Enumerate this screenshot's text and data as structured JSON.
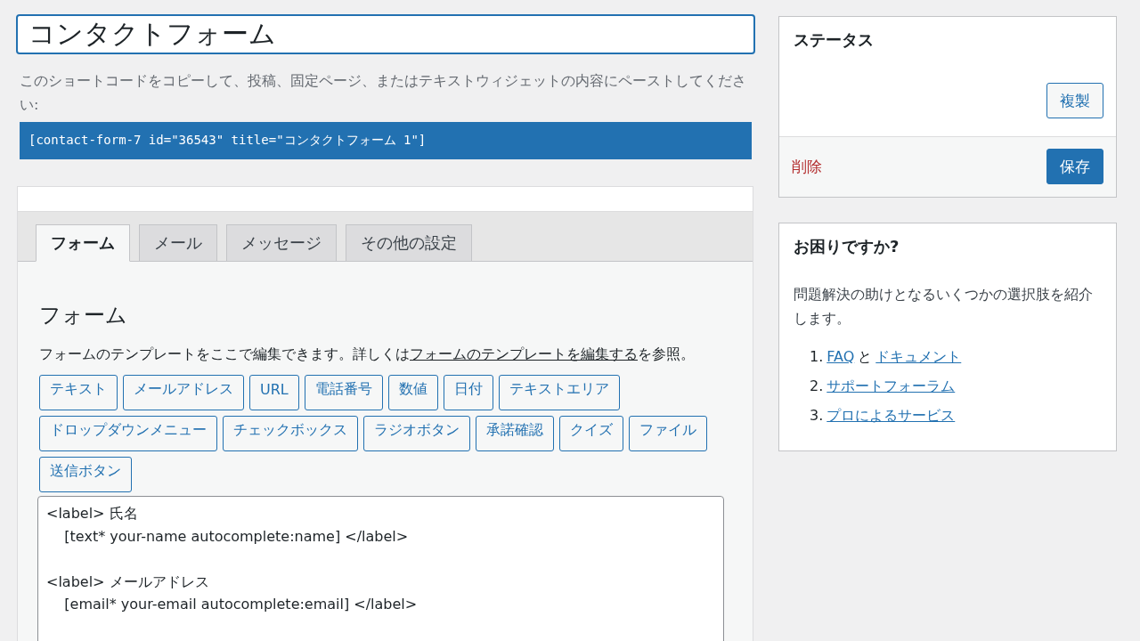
{
  "form_title": {
    "value": "コンタクトフォーム"
  },
  "shortcode": {
    "hint": "このショートコードをコピーして、投稿、固定ページ、またはテキストウィジェットの内容にペーストしてください:",
    "code": "[contact-form-7 id=\"36543\" title=\"コンタクトフォーム 1\"]"
  },
  "tabs": [
    {
      "label": "フォーム",
      "selected": true
    },
    {
      "label": "メール",
      "selected": false
    },
    {
      "label": "メッセージ",
      "selected": false
    },
    {
      "label": "その他の設定",
      "selected": false
    }
  ],
  "form_panel": {
    "heading": "フォーム",
    "description": [
      {
        "kind": "text",
        "text": "フォームのテンプレートをここで編集できます。詳しくは"
      },
      {
        "kind": "link",
        "text": "フォームのテンプレートを編集する"
      },
      {
        "kind": "text",
        "text": "を参照。"
      }
    ],
    "tag_buttons": [
      "テキスト",
      "メールアドレス",
      "URL",
      "電話番号",
      "数値",
      "日付",
      "テキストエリア",
      "ドロップダウンメニュー",
      "チェックボックス",
      "ラジオボタン",
      "承諾確認",
      "クイズ",
      "ファイル",
      "送信ボタン"
    ],
    "template": "<label> 氏名\n    [text* your-name autocomplete:name] </label>\n\n<label> メールアドレス\n    [email* your-email autocomplete:email] </label>"
  },
  "status_box": {
    "title": "ステータス",
    "duplicate_button": "複製",
    "delete_link": "削除",
    "save_button": "保存"
  },
  "help_box": {
    "title": "お困りですか?",
    "text": "問題解決の助けとなるいくつかの選択肢を紹介します。",
    "items": [
      {
        "number": "1.",
        "parts": [
          {
            "kind": "link",
            "text": "FAQ"
          },
          {
            "kind": "text",
            "text": "と"
          },
          {
            "kind": "link",
            "text": "ドキュメント"
          }
        ]
      },
      {
        "number": "2.",
        "parts": [
          {
            "kind": "link",
            "text": "サポートフォーラム"
          }
        ]
      },
      {
        "number": "3.",
        "parts": [
          {
            "kind": "link",
            "text": "プロによるサービス"
          }
        ]
      }
    ]
  }
}
